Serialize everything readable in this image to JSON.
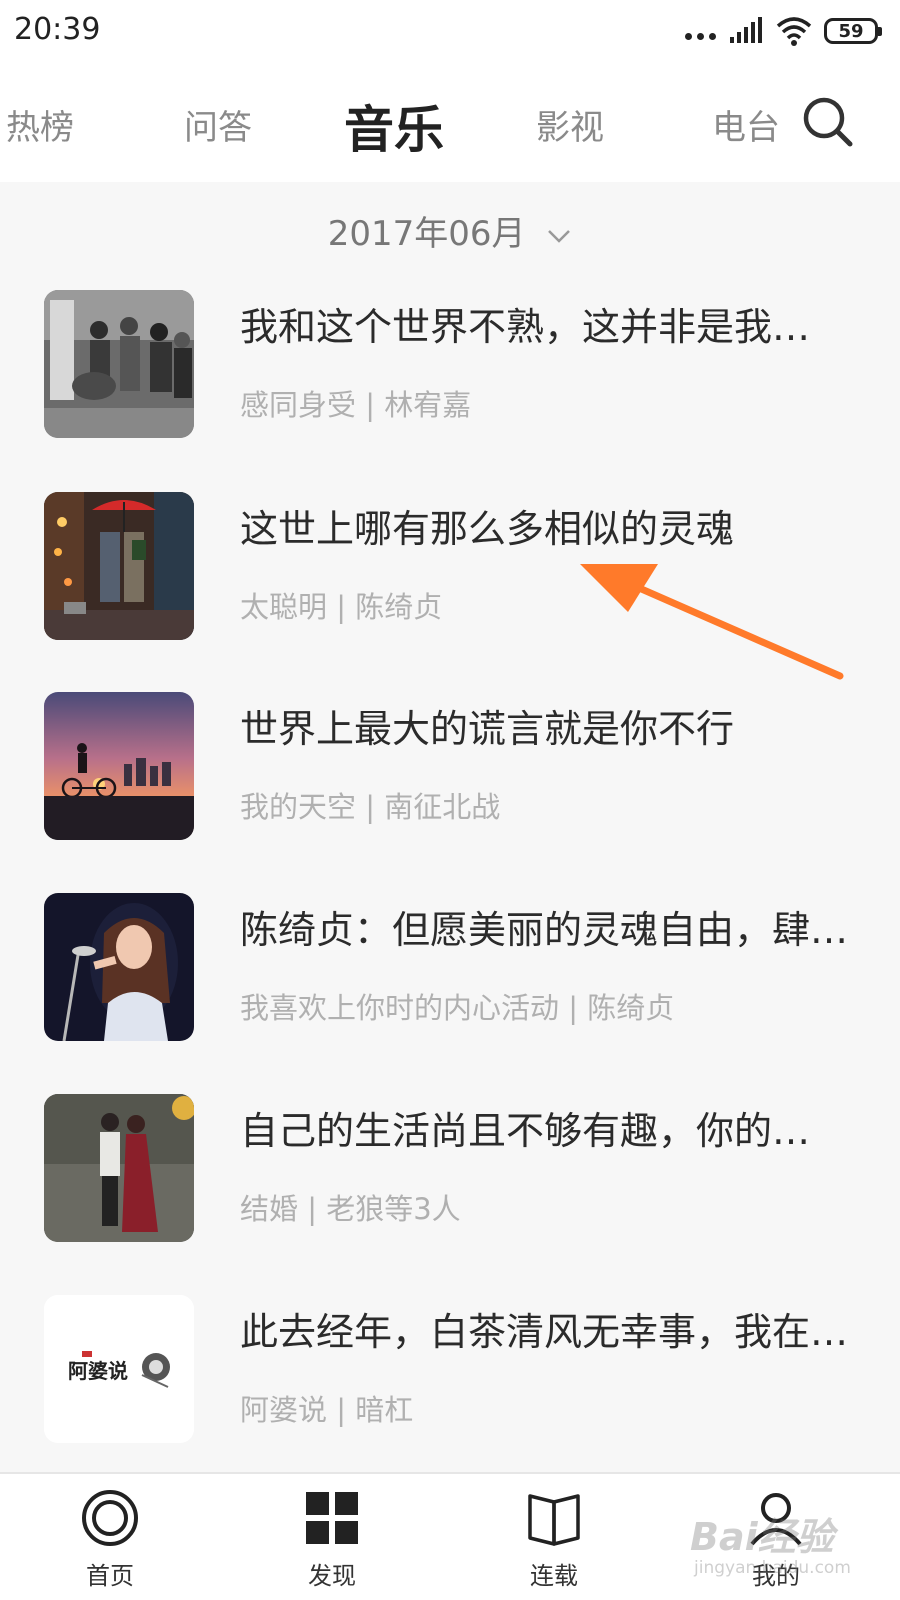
{
  "status_bar": {
    "time": "20:39",
    "battery": "59"
  },
  "top_tabs": [
    {
      "label": "热榜",
      "active": false
    },
    {
      "label": "问答",
      "active": false
    },
    {
      "label": "音乐",
      "active": true
    },
    {
      "label": "影视",
      "active": false
    },
    {
      "label": "电台",
      "active": false
    }
  ],
  "month_selector": {
    "label": "2017年06月"
  },
  "list": [
    {
      "title": "我和这个世界不熟，这并非是我…",
      "subtitle": "感同身受 | 林宥嘉"
    },
    {
      "title": "这世上哪有那么多相似的灵魂",
      "subtitle": "太聪明 | 陈绮贞"
    },
    {
      "title": "世界上最大的谎言就是你不行",
      "subtitle": "我的天空 | 南征北战"
    },
    {
      "title": "陈绮贞：但愿美丽的灵魂自由，肆…",
      "subtitle": "我喜欢上你时的内心活动 | 陈绮贞"
    },
    {
      "title": "自己的生活尚且不够有趣，你的…",
      "subtitle": "结婚 | 老狼等3人"
    },
    {
      "title": "此去经年，白茶清风无幸事，我在…",
      "subtitle": "阿婆说 | 暗杠"
    }
  ],
  "thumb_logo_text": "阿婆说",
  "bottom_nav": [
    {
      "label": "首页",
      "icon": "home-icon"
    },
    {
      "label": "发现",
      "icon": "grid-icon"
    },
    {
      "label": "连载",
      "icon": "book-icon"
    },
    {
      "label": "我的",
      "icon": "user-icon"
    }
  ],
  "watermark": {
    "main": "Bai经验",
    "sub": "jingyan.baidu.com"
  },
  "colors": {
    "annotation_arrow": "#ff7a2a",
    "background": "#f7f7f7"
  }
}
